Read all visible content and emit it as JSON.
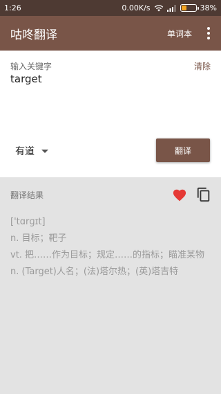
{
  "status": {
    "time": "1:26",
    "speed": "0.00K/s",
    "battery_percent": "38%",
    "battery_level": 0.38
  },
  "appbar": {
    "title": "咕咚翻译",
    "vocab_label": "单词本"
  },
  "input": {
    "label": "输入关键字",
    "clear_label": "清除",
    "value": "target"
  },
  "controls": {
    "engine": "有道",
    "translate_label": "翻译"
  },
  "result": {
    "label": "翻译结果",
    "lines": [
      "['tɑrɡɪt]",
      "n. 目标；靶子",
      "vt. 把……作为目标；规定……的指标；瞄准某物",
      "n. (Target)人名；(法)塔尔热；(英)塔吉特"
    ]
  },
  "colors": {
    "primary": "#795548",
    "status_bar": "#4e3a33",
    "heart": "#e53935"
  }
}
